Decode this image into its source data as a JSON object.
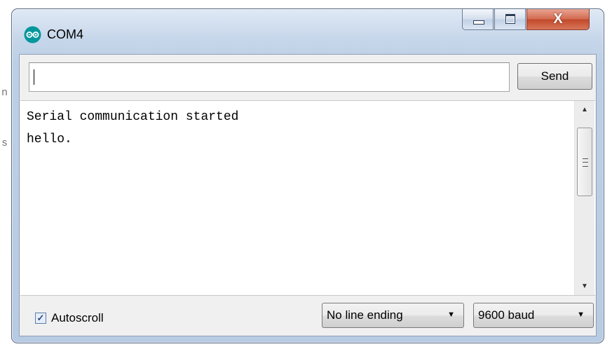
{
  "window": {
    "title": "COM4",
    "close_glyph": "X",
    "controls": [
      "minimize-icon",
      "maximize-icon",
      "close-icon"
    ]
  },
  "background_fragments": [
    "n",
    "s"
  ],
  "send_bar": {
    "input_value": "",
    "send_label": "Send"
  },
  "output": {
    "lines": [
      "Serial communication started",
      "hello."
    ]
  },
  "footer": {
    "autoscroll": {
      "label": "Autoscroll",
      "checked": true,
      "check_glyph": "✓"
    },
    "line_ending": {
      "selected": "No line ending"
    },
    "baud_rate": {
      "selected": "9600 baud"
    }
  },
  "colors": {
    "titlebar_accent": "#bccfe6",
    "close_button": "#c2482a",
    "app_icon": "#00979c"
  }
}
